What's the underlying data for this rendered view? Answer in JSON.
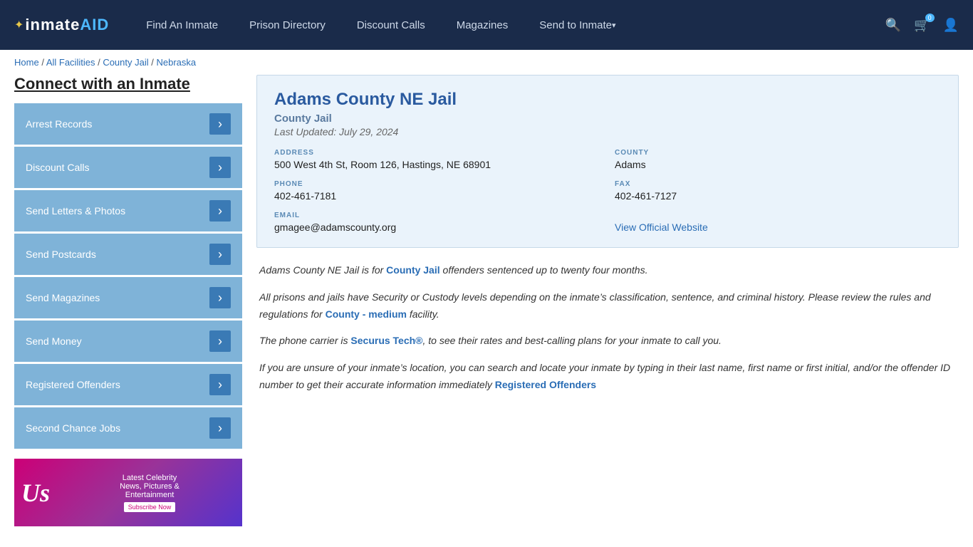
{
  "header": {
    "logo": "inmate",
    "logo_suffix": "AID",
    "nav_items": [
      {
        "label": "Find An Inmate",
        "id": "find-inmate",
        "dropdown": false
      },
      {
        "label": "Prison Directory",
        "id": "prison-directory",
        "dropdown": false
      },
      {
        "label": "Discount Calls",
        "id": "discount-calls",
        "dropdown": false
      },
      {
        "label": "Magazines",
        "id": "magazines",
        "dropdown": false
      },
      {
        "label": "Send to Inmate",
        "id": "send-to-inmate",
        "dropdown": true
      }
    ],
    "cart_count": "0"
  },
  "breadcrumb": {
    "items": [
      {
        "label": "Home",
        "href": "#"
      },
      {
        "label": "All Facilities",
        "href": "#"
      },
      {
        "label": "County Jail",
        "href": "#"
      },
      {
        "label": "Nebraska",
        "href": "#"
      }
    ]
  },
  "sidebar": {
    "title": "Connect with an Inmate",
    "menu_items": [
      {
        "label": "Arrest Records"
      },
      {
        "label": "Discount Calls"
      },
      {
        "label": "Send Letters & Photos"
      },
      {
        "label": "Send Postcards"
      },
      {
        "label": "Send Magazines"
      },
      {
        "label": "Send Money"
      },
      {
        "label": "Registered Offenders"
      },
      {
        "label": "Second Chance Jobs"
      }
    ],
    "ad": {
      "logo": "Us",
      "line1": "Latest Celebrity",
      "line2": "News, Pictures &",
      "line3": "Entertainment",
      "btn_label": "Subscribe Now"
    }
  },
  "facility": {
    "name": "Adams County NE Jail",
    "type": "County Jail",
    "last_updated": "Last Updated: July 29, 2024",
    "address_label": "ADDRESS",
    "address": "500 West 4th St, Room 126, Hastings, NE 68901",
    "county_label": "COUNTY",
    "county": "Adams",
    "phone_label": "PHONE",
    "phone": "402-461-7181",
    "fax_label": "FAX",
    "fax": "402-461-7127",
    "email_label": "EMAIL",
    "email": "gmagee@adamscounty.org",
    "website_label": "View Official Website"
  },
  "description": {
    "para1": "Adams County NE Jail is for ",
    "para1_bold": "County Jail",
    "para1_rest": " offenders sentenced up to twenty four months.",
    "para2": "All prisons and jails have Security or Custody levels depending on the inmate’s classification, sentence, and criminal history. Please review the rules and regulations for ",
    "para2_bold": "County - medium",
    "para2_rest": " facility.",
    "para3": "The phone carrier is ",
    "para3_bold": "Securus Tech®",
    "para3_rest": ", to see their rates and best-calling plans for your inmate to call you.",
    "para4": "If you are unsure of your inmate’s location, you can search and locate your inmate by typing in their last name, first name or first initial, and/or the offender ID number to get their accurate information immediately",
    "para4_bold": "Registered Offenders"
  }
}
